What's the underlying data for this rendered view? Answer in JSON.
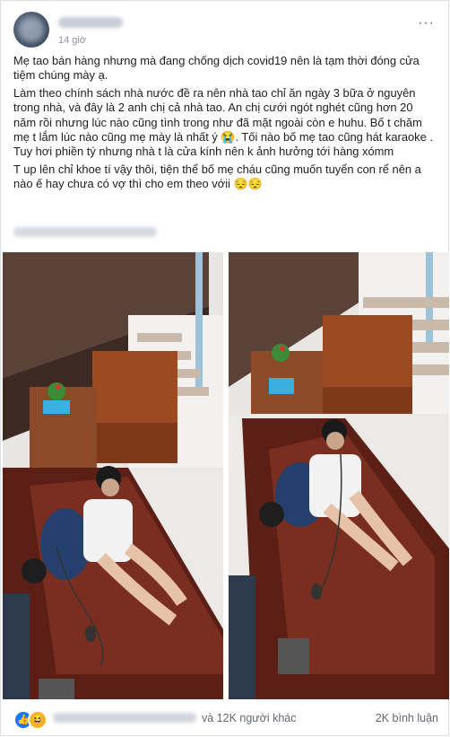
{
  "post": {
    "timestamp": "14 giờ",
    "more_label": "···",
    "paragraphs": [
      "Mẹ tao bán hàng nhưng mà đang chống dịch covid19 nên là tạm thời đóng cửa tiệm chúng mày ạ.",
      "Làm theo chính sách nhà nước đề ra nên nhà tao chỉ ăn ngày 3 bữa ở nguyên trong nhà, và đây là 2 anh chị cả nhà tao. An chị cưới ngót nghét cũng hơn 20 năm rồi nhưng lúc nào cũng tình trong như đã mặt ngoài còn e huhu. Bố t chăm mẹ t lắm lúc nào cũng mẹ mày là nhất ý 😭. Tối nào bố mẹ tao cũng hát karaoke . Tuy hơi phiền tý nhưng nhà t là cửa kính nên k ảnh hưởng tới hàng xómm",
      "T up lên chỉ khoe tí vậy thôi, tiện thể bố mẹ cháu cũng muốn tuyển con rể nên a nào ế hay chưa có vợ thì cho em theo vớii 😔😔"
    ]
  },
  "footer": {
    "like_icon": "👍",
    "haha_icon": "😆",
    "others_text": "và 12K người khác",
    "comments_text": "2K bình luận"
  },
  "colors": {
    "accent": "#1877f2",
    "meta_text": "#606770"
  }
}
